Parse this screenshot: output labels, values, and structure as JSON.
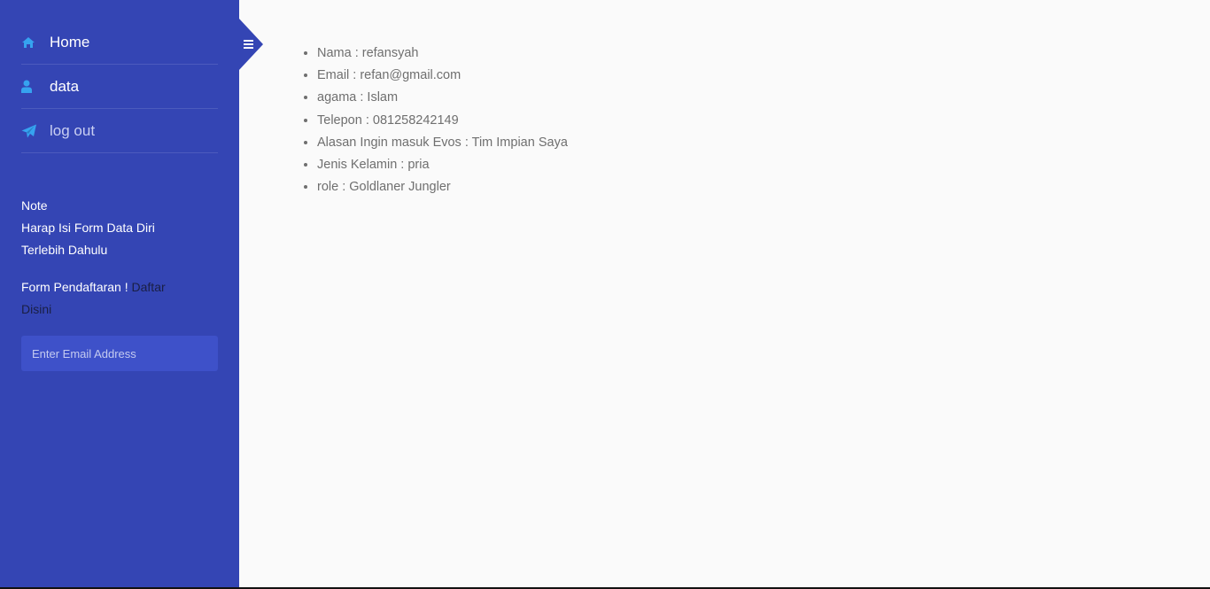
{
  "sidebar": {
    "nav": [
      {
        "label": "Home",
        "icon": "home-icon"
      },
      {
        "label": "data",
        "icon": "user-icon"
      },
      {
        "label": "log out",
        "icon": "paper-plane-icon"
      }
    ],
    "note_title": "Note",
    "note_line1": "Harap Isi Form Data Diri",
    "note_line2": "Terlebih Dahulu",
    "form_text": "Form Pendaftaran !",
    "form_link": "Daftar Disini",
    "email_placeholder": "Enter Email Address"
  },
  "details": [
    "Nama : refansyah",
    "Email : refan@gmail.com",
    "agama : Islam",
    "Telepon : 081258242149",
    "Alasan Ingin masuk Evos : Tim Impian Saya",
    "Jenis Kelamin : pria",
    "role : Goldlaner Jungler"
  ],
  "colors": {
    "sidebar_bg": "#3445b4",
    "icon_accent": "#36a3f0",
    "content_bg": "#fafafa",
    "text_gray": "#6f6f6f"
  }
}
